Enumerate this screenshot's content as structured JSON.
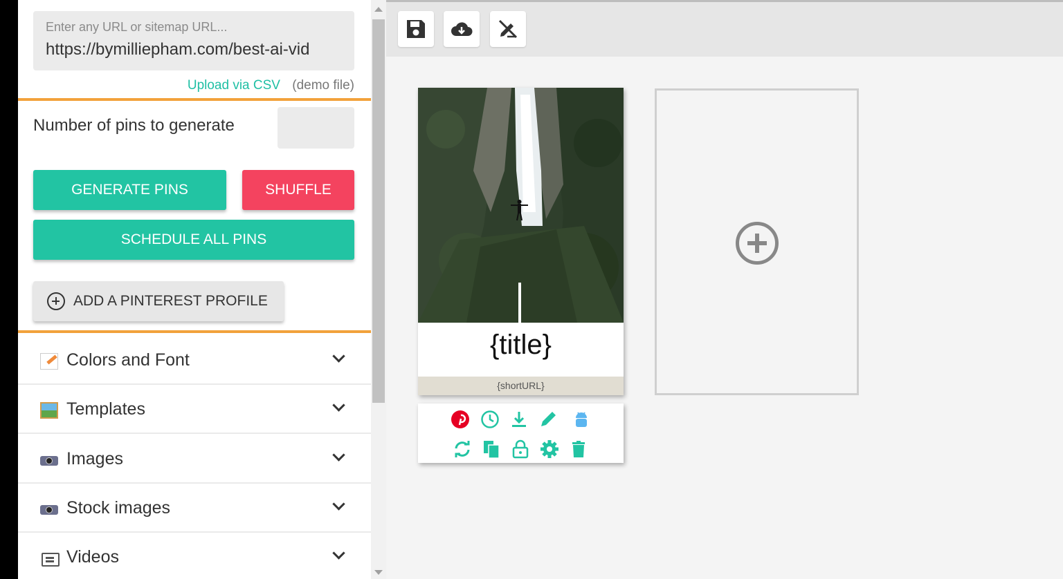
{
  "sidebar": {
    "url_input": {
      "placeholder": "Enter any URL or sitemap URL...",
      "value": "https://bymilliepham.com/best-ai-vid"
    },
    "upload_csv_label": "Upload via CSV",
    "demo_file_label": "(demo file)",
    "pins_count_label": "Number of pins to generate",
    "pins_count_value": "",
    "generate_label": "GENERATE PINS",
    "shuffle_label": "SHUFFLE",
    "schedule_label": "SCHEDULE ALL PINS",
    "add_profile_label": "ADD A PINTEREST PROFILE",
    "sections": [
      {
        "label": "Colors and Font",
        "icon": "note-icon"
      },
      {
        "label": "Templates",
        "icon": "picture-icon"
      },
      {
        "label": "Images",
        "icon": "camera-icon"
      },
      {
        "label": "Stock images",
        "icon": "camera-icon"
      },
      {
        "label": "Videos",
        "icon": "video-icon"
      }
    ]
  },
  "toolbar": {
    "buttons": [
      "save-icon",
      "cloud-download-icon",
      "no-edit-icon"
    ]
  },
  "pin": {
    "title": "{title}",
    "short_url": "{shortURL}",
    "actions_row1": [
      "pinterest-icon",
      "clock-icon",
      "download-icon",
      "pencil-icon",
      "android-icon"
    ],
    "actions_row2": [
      "refresh-icon",
      "copy-icon",
      "lock-icon",
      "gear-icon",
      "trash-icon"
    ]
  },
  "colors": {
    "teal": "#22c4a3",
    "red": "#f4435f",
    "highlight": "#f2a23b",
    "pinterest": "#e60023"
  }
}
